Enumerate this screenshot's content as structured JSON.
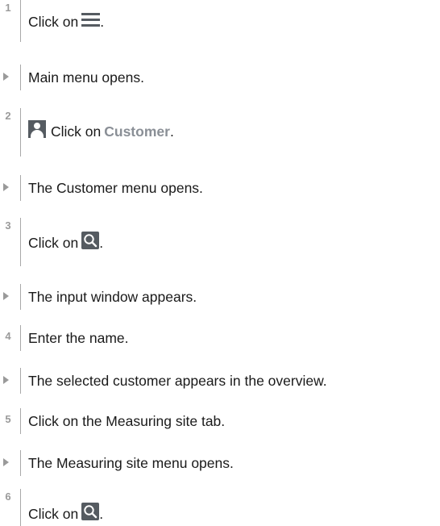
{
  "steps": [
    {
      "marker": "1",
      "type": "step",
      "text_before": "Click on",
      "text_after": "."
    },
    {
      "type": "result",
      "text": "Main menu opens."
    },
    {
      "marker": "2",
      "type": "step",
      "text_before": "Click on",
      "term": "Customer",
      "text_after": "."
    },
    {
      "type": "result",
      "text": "The Customer menu opens."
    },
    {
      "marker": "3",
      "type": "step",
      "text_before": "Click on",
      "text_after": "."
    },
    {
      "type": "result",
      "text": "The input window appears."
    },
    {
      "marker": "4",
      "type": "step",
      "text": "Enter the name."
    },
    {
      "type": "result",
      "text": "The selected customer appears in the overview."
    },
    {
      "marker": "5",
      "type": "step",
      "text": "Click on the Measuring site tab."
    },
    {
      "type": "result",
      "text": "The Measuring site menu opens."
    },
    {
      "marker": "6",
      "type": "step",
      "text_before": "Click on",
      "text_after": "."
    }
  ],
  "icons": {
    "step1": "hamburger-menu-icon",
    "step2": "person-icon",
    "step3": "search-icon",
    "step6": "search-icon"
  },
  "colors": {
    "marker": "#9a9a9a",
    "icon": "#555b61",
    "term": "#8a8f96"
  }
}
